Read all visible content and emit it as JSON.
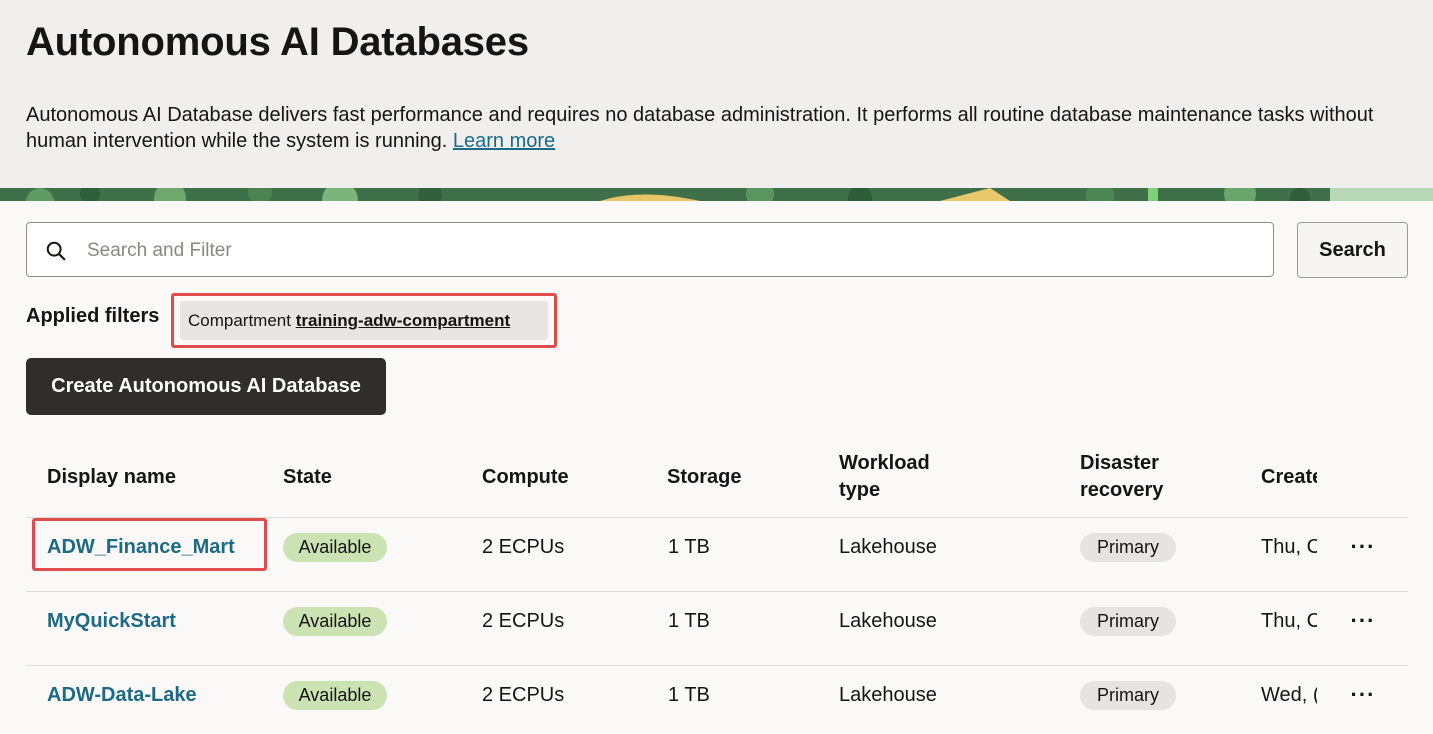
{
  "header": {
    "title": "Autonomous AI Databases",
    "description": "Autonomous AI Database delivers fast performance and requires no database administration. It performs all routine database maintenance tasks without human intervention while the system is running.",
    "learn_more": "Learn more"
  },
  "search": {
    "placeholder": "Search and Filter",
    "button_label": "Search"
  },
  "filters": {
    "label": "Applied filters",
    "chip_key": "Compartment",
    "chip_value": "training-adw-compartment"
  },
  "actions": {
    "create_label": "Create Autonomous AI Database"
  },
  "table": {
    "headers": {
      "display_name": "Display name",
      "state": "State",
      "compute": "Compute",
      "storage": "Storage",
      "workload_line1": "Workload",
      "workload_line2": "type",
      "dr_line1": "Disaster",
      "dr_line2": "recovery",
      "created": "Create"
    },
    "rows": [
      {
        "name": "ADW_Finance_Mart",
        "state": "Available",
        "compute": "2 ECPUs",
        "storage": "1 TB",
        "workload": "Lakehouse",
        "dr": "Primary",
        "created": "Thu, C",
        "more": "···"
      },
      {
        "name": "MyQuickStart",
        "state": "Available",
        "compute": "2 ECPUs",
        "storage": "1 TB",
        "workload": "Lakehouse",
        "dr": "Primary",
        "created": "Thu, C",
        "more": "···"
      },
      {
        "name": "ADW-Data-Lake",
        "state": "Available",
        "compute": "2 ECPUs",
        "storage": "1 TB",
        "workload": "Lakehouse",
        "dr": "Primary",
        "created": "Wed, (",
        "more": "···"
      }
    ]
  },
  "colors": {
    "link": "#1c6a86",
    "available_badge": "#cbe3b3",
    "primary_badge": "#e6e3e0",
    "highlight": "#e04c4c",
    "create_button": "#312d2a"
  }
}
